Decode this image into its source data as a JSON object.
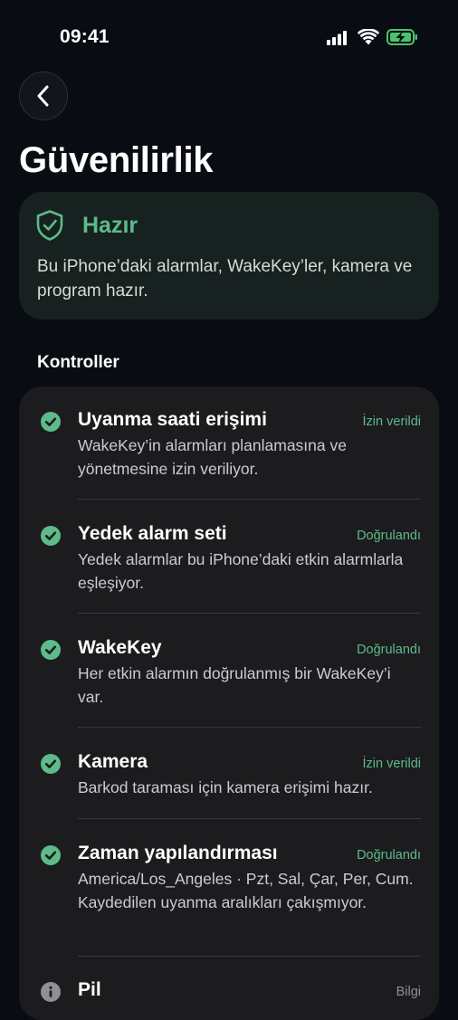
{
  "status_bar": {
    "time": "09:41"
  },
  "header": {
    "back_icon": "chevron-left-icon",
    "title": "Güvenilirlik"
  },
  "status_card": {
    "icon": "shield-check-icon",
    "headline": "Hazır",
    "description": "Bu iPhone’daki alarmlar, WakeKey’ler, kamera ve program hazır."
  },
  "checks": {
    "section_title": "Kontroller",
    "items": [
      {
        "title": "Uyanma saati erişimi",
        "badge": "İzin verildi",
        "description": "WakeKey’in alarmları planlamasına ve yönetmesine izin veriliyor.",
        "icon": "check-circle-icon"
      },
      {
        "title": "Yedek alarm seti",
        "badge": "Doğrulandı",
        "description": "Yedek alarmlar bu iPhone’daki etkin alarmlarla eşleşiyor.",
        "icon": "check-circle-icon"
      },
      {
        "title": "WakeKey",
        "badge": "Doğrulandı",
        "description": "Her etkin alarmın doğrulanmış bir WakeKey’i var.",
        "icon": "check-circle-icon"
      },
      {
        "title": "Kamera",
        "badge": "İzin verildi",
        "description": "Barkod taraması için kamera erişimi hazır.",
        "icon": "check-circle-icon"
      },
      {
        "title": "Zaman yapılandırması",
        "badge": "Doğrulandı",
        "description": "America/Los_Angeles · Pzt, Sal, Çar, Per, Cum. Kaydedilen uyanma aralıkları çakışmıyor.",
        "icon": "check-circle-icon"
      },
      {
        "title": "Pil",
        "badge": "Bilgi",
        "icon": "info-circle-icon"
      }
    ]
  },
  "colors": {
    "background": "#090c12",
    "accent_green": "#5dbb8a",
    "card": "#1c1c1e",
    "status_card": "#17211f"
  }
}
